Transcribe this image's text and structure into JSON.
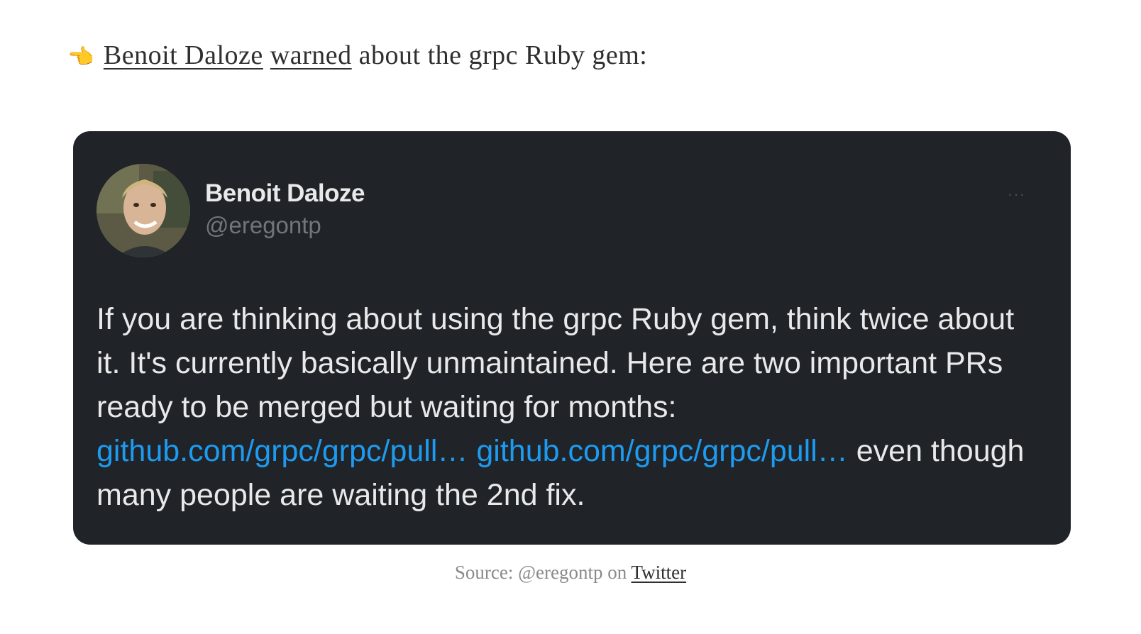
{
  "intro": {
    "hand_emoji": "👉",
    "author_link": "Benoit Daloze",
    "warned_link": "warned",
    "rest": "about the grpc Ruby gem:"
  },
  "tweet": {
    "name": "Benoit Daloze",
    "handle": "@eregontp",
    "more": "···",
    "text_1": "If you are thinking about using the grpc Ruby gem, think twice about it. It's currently basically unmaintained. Here are two important PRs ready to be merged but waiting for months: ",
    "link_1": "github.com/grpc/grpc/pull…",
    "link_2": "github.com/grpc/grpc/pull…",
    "text_2": " even though many people are waiting the 2nd fix."
  },
  "caption": {
    "prefix": "Source: @eregontp on ",
    "link": "Twitter"
  },
  "colors": {
    "tweet_bg": "#202327",
    "link_blue": "#1d9bf0",
    "text_light": "#e7e9ea",
    "handle_gray": "#71767b"
  }
}
